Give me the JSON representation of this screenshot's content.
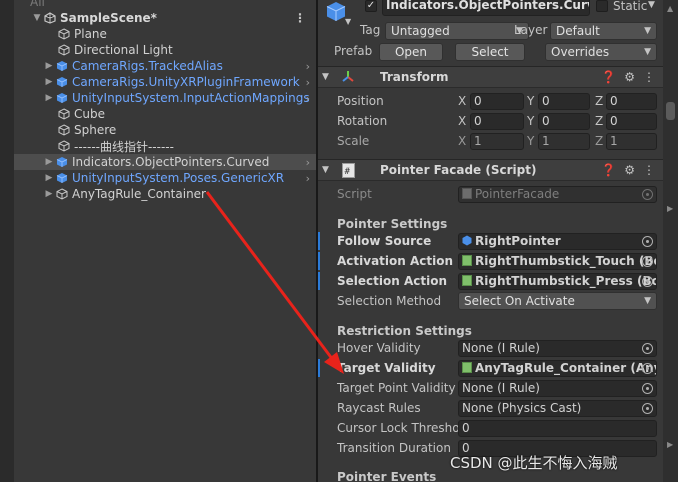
{
  "hierarchy": {
    "search_placeholder": "All",
    "scene_name": "SampleScene*",
    "items": [
      {
        "label": "Plane",
        "color": "default"
      },
      {
        "label": "Directional Light",
        "color": "default"
      },
      {
        "label": "CameraRigs.TrackedAlias",
        "color": "blue"
      },
      {
        "label": "CameraRigs.UnityXRPluginFramework",
        "color": "blue"
      },
      {
        "label": "UnityInputSystem.InputActionMappings",
        "color": "blue"
      },
      {
        "label": "Cube",
        "color": "default"
      },
      {
        "label": "Sphere",
        "color": "default"
      },
      {
        "label": "------曲线指针------",
        "color": "default"
      },
      {
        "label": "Indicators.ObjectPointers.Curved",
        "color": "default"
      },
      {
        "label": "UnityInputSystem.Poses.GenericXR",
        "color": "blue"
      },
      {
        "label": "AnyTagRule_Container",
        "color": "default"
      }
    ]
  },
  "inspector": {
    "object_name": "Indicators.ObjectPointers.Curved",
    "static_label": "Static",
    "tag_label": "Tag",
    "tag_value": "Untagged",
    "layer_label": "Layer",
    "layer_value": "Default",
    "prefab_label": "Prefab",
    "open_label": "Open",
    "select_label": "Select",
    "overrides_label": "Overrides",
    "transform": {
      "title": "Transform",
      "position_label": "Position",
      "rotation_label": "Rotation",
      "scale_label": "Scale",
      "axis_x": "X",
      "axis_y": "Y",
      "axis_z": "Z",
      "position": [
        "0",
        "0",
        "0"
      ],
      "rotation": [
        "0",
        "0",
        "0"
      ],
      "scale": [
        "1",
        "1",
        "1"
      ]
    },
    "pointer_facade": {
      "title": "Pointer Facade (Script)",
      "script_label": "Script",
      "script_value": "PointerFacade",
      "pointer_settings_header": "Pointer Settings",
      "follow_source_label": "Follow Source",
      "follow_source_value": "RightPointer",
      "activation_action_label": "Activation Action",
      "activation_action_value": "RightThumbstick_Touch (Bo",
      "selection_action_label": "Selection Action",
      "selection_action_value": "RightThumbstick_Press (Bo",
      "selection_method_label": "Selection Method",
      "selection_method_value": "Select On Activate",
      "restriction_settings_header": "Restriction Settings",
      "hover_validity_label": "Hover Validity",
      "hover_validity_value": "None (I Rule)",
      "target_validity_label": "Target Validity",
      "target_validity_value": "AnyTagRule_Container (Any",
      "target_point_validity_label": "Target Point Validity",
      "target_point_validity_value": "None (I Rule)",
      "raycast_rules_label": "Raycast Rules",
      "raycast_rules_value": "None (Physics Cast)",
      "cursor_lock_label": "Cursor Lock Threshol",
      "cursor_lock_value": "0",
      "transition_duration_label": "Transition Duration",
      "transition_duration_value": "0",
      "pointer_events_header": "Pointer Events"
    }
  },
  "watermark": "CSDN @此生不悔入海贼",
  "colors": {
    "prefab_blue": "#6fa7ff",
    "annotation_red": "#e8231b",
    "override_mark": "#2b7bd9"
  }
}
